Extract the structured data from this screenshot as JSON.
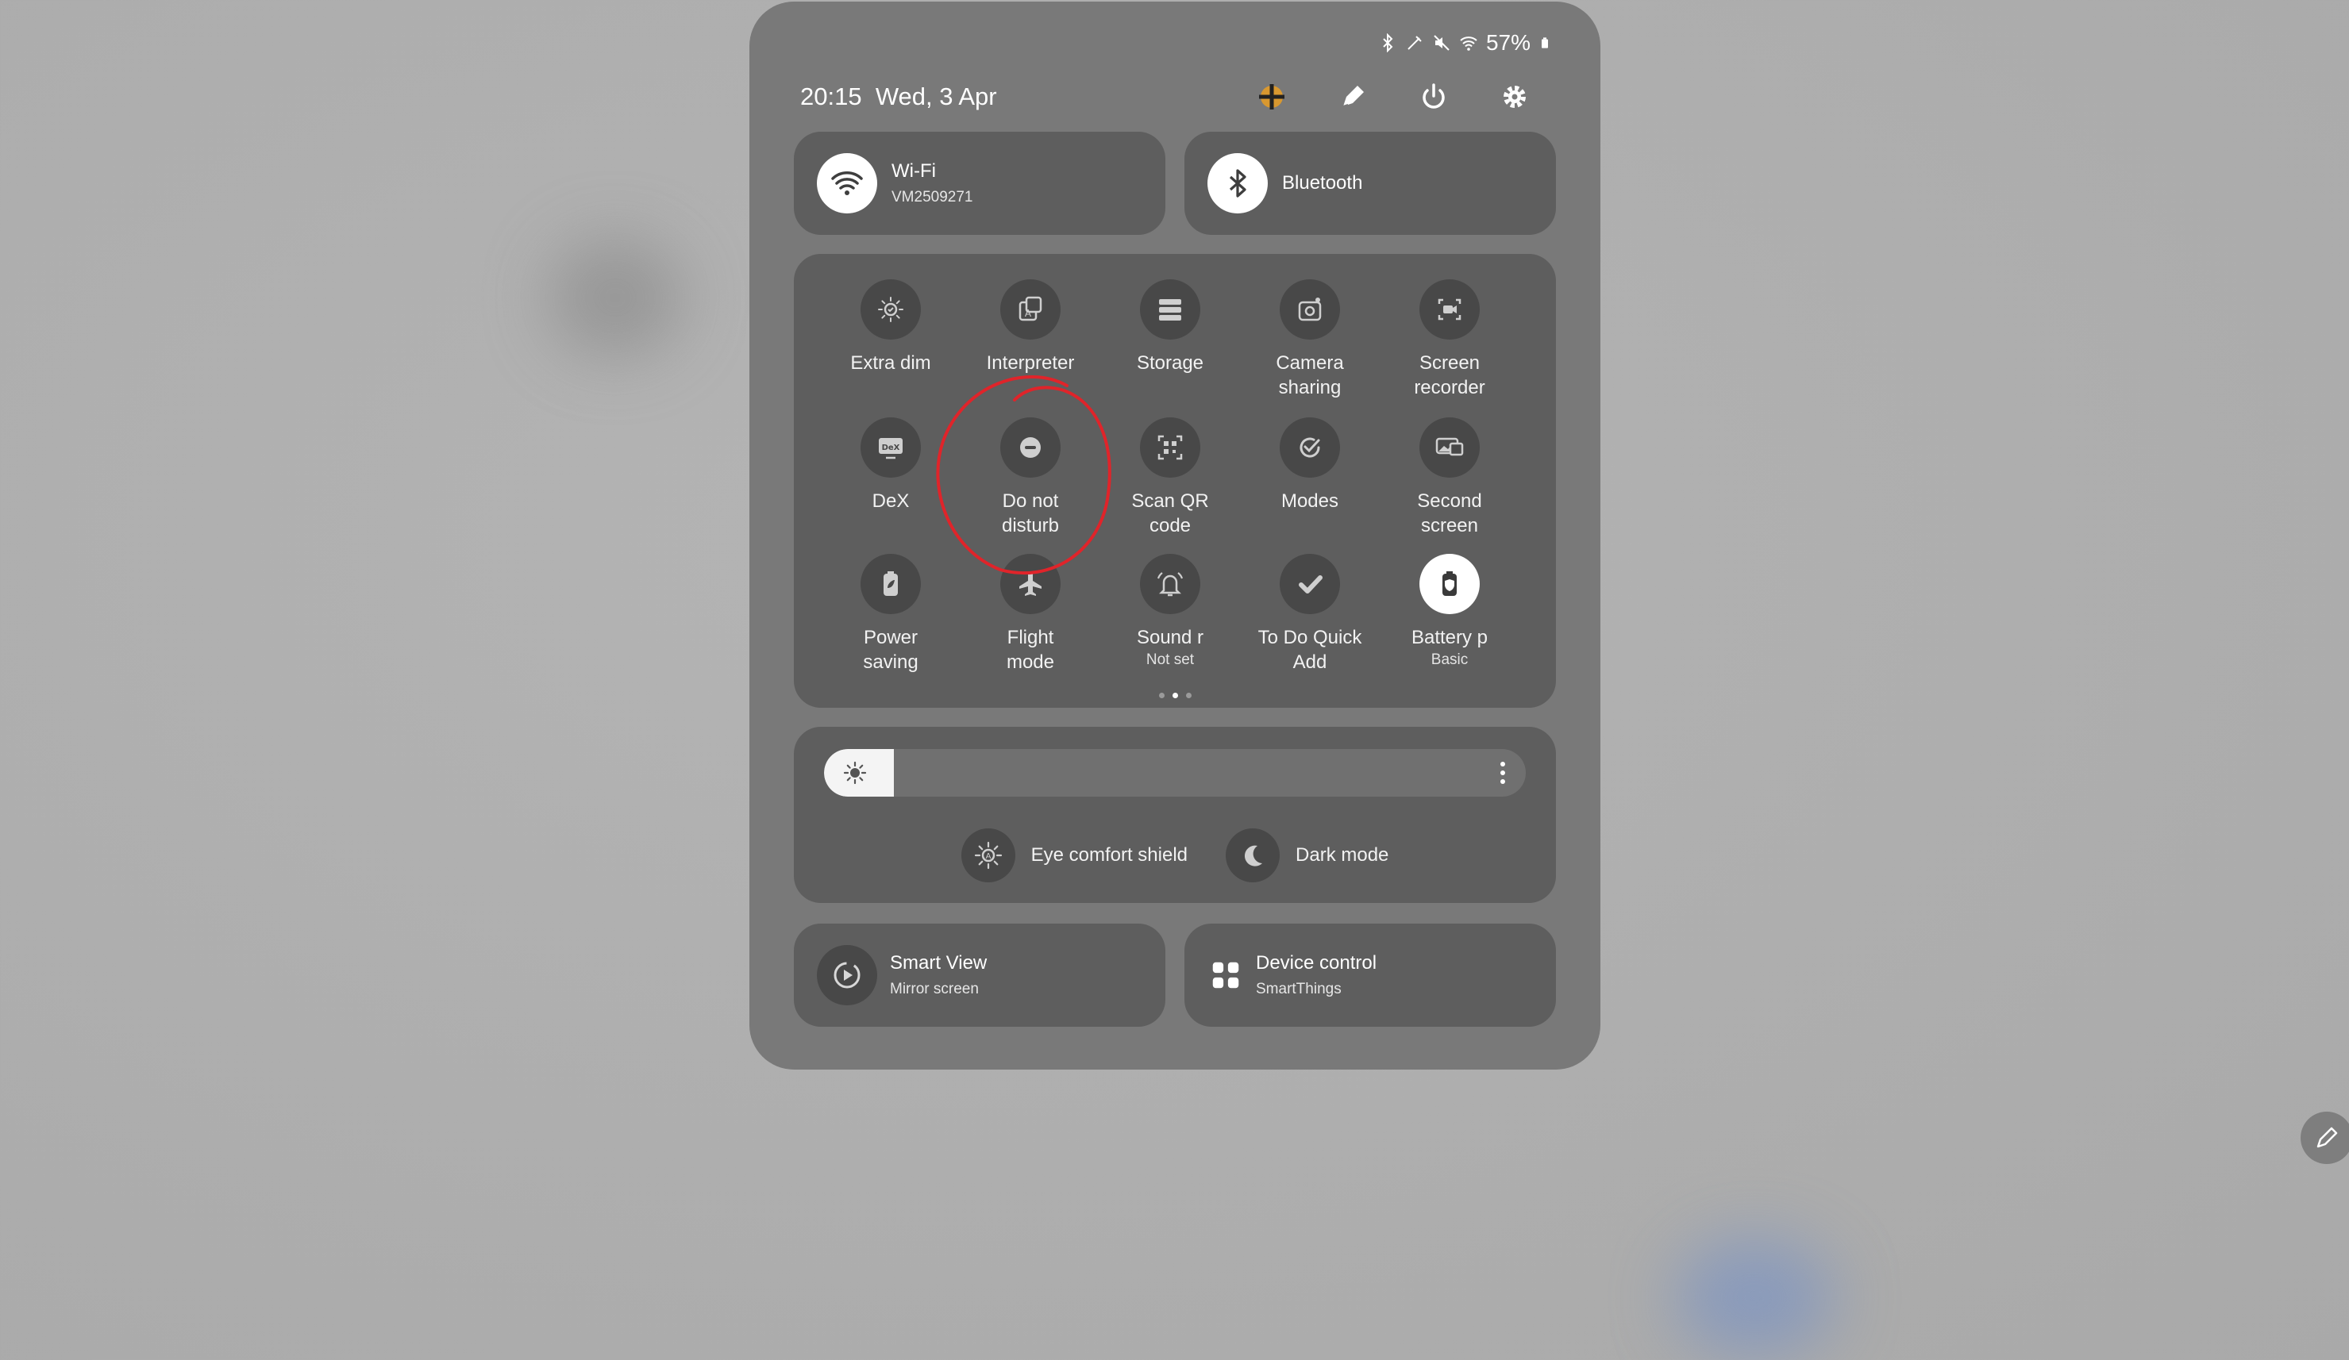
{
  "status_bar": {
    "battery": "57%"
  },
  "header": {
    "time": "20:15",
    "date": "Wed, 3 Apr"
  },
  "top_actions": [
    "finder-icon",
    "edit-icon",
    "power-icon",
    "settings-icon"
  ],
  "connectivity": {
    "wifi": {
      "label": "Wi-Fi",
      "sub": "VM2509271",
      "active": true
    },
    "bluetooth": {
      "label": "Bluetooth",
      "active": true
    }
  },
  "quick_tiles": [
    {
      "label": "Extra dim",
      "icon": "extra-dim-icon"
    },
    {
      "label": "Interpreter",
      "icon": "interpreter-icon"
    },
    {
      "label": "Storage",
      "icon": "storage-icon"
    },
    {
      "label": "Camera\nsharing",
      "icon": "camera-sharing-icon"
    },
    {
      "label": "Screen\nrecorder",
      "icon": "screen-recorder-icon"
    },
    {
      "label": "DeX",
      "icon": "dex-icon"
    },
    {
      "label": "Do not\ndisturb",
      "icon": "do-not-disturb-icon"
    },
    {
      "label": "Scan QR\ncode",
      "icon": "qr-scan-icon"
    },
    {
      "label": "Modes",
      "icon": "modes-icon"
    },
    {
      "label": "Second\nscreen",
      "icon": "second-screen-icon"
    },
    {
      "label": "Power\nsaving",
      "icon": "power-saving-icon"
    },
    {
      "label": "Flight\nmode",
      "icon": "airplane-icon"
    },
    {
      "label": "Sound r",
      "sub": "Not set",
      "icon": "sound-icon"
    },
    {
      "label": "To Do Quick\nAdd",
      "icon": "todo-icon"
    },
    {
      "label": "Battery p",
      "sub": "Basic",
      "icon": "battery-protect-icon",
      "active": true
    }
  ],
  "page_indicator": {
    "pages": 3,
    "current": 2
  },
  "brightness": {
    "level": 0.1
  },
  "display_toggles": {
    "eye_comfort": "Eye comfort shield",
    "dark_mode": "Dark mode"
  },
  "bottom": {
    "smart_view": {
      "label": "Smart View",
      "sub": "Mirror screen"
    },
    "device_control": {
      "label": "Device control",
      "sub": "SmartThings"
    }
  },
  "colors": {
    "panel": "#797979",
    "tile": "#5e5e5e",
    "icon_bg": "#484848",
    "annotation": "#e0242a"
  }
}
